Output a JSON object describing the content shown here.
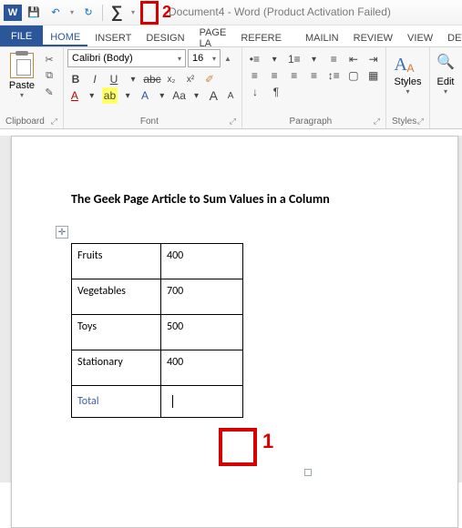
{
  "title": "Document4 - Word (Product Activation Failed)",
  "qat": {
    "word": "W",
    "save": "💾",
    "undo": "↶",
    "redo": "↻",
    "sum": "∑",
    "dropdown": "▾"
  },
  "callouts": {
    "one": "1",
    "two": "2"
  },
  "tabs": {
    "file": "FILE",
    "home": "HOME",
    "insert": "INSERT",
    "design": "DESIGN",
    "pagelayout": "PAGE LA",
    "references": "REFERE",
    "mailings": "MAILIN",
    "review": "REVIEW",
    "view": "VIEW",
    "developer": "DEVELO"
  },
  "ribbon": {
    "clipboard": {
      "paste": "Paste",
      "label": "Clipboard",
      "cut": "✂",
      "copy": "⧉",
      "fmt": "✎"
    },
    "font": {
      "name": "Calibri (Body)",
      "size": "16",
      "label": "Font",
      "bold": "B",
      "italic": "I",
      "underline": "U",
      "strike": "abc",
      "sub": "x₂",
      "sup": "x²",
      "clear": "✐",
      "fontcolor": "A",
      "highlight": "ab",
      "case": "Aa",
      "grow": "A",
      "shrink": "A",
      "drop": "▾"
    },
    "paragraph": {
      "label": "Paragraph",
      "bullets": "•≡",
      "numbers": "1≡",
      "multi": "≡",
      "decind": "⇤",
      "incind": "⇥",
      "left": "≡",
      "center": "≡",
      "right": "≡",
      "just": "≡",
      "lines": "↕≡",
      "shade": "▢",
      "border": "▦",
      "sort": "↓",
      "pilcrow": "¶"
    },
    "styles": {
      "label": "Styles",
      "text": "Styles",
      "drop": "▾"
    },
    "editing": {
      "label": "Edit",
      "find": "🔍"
    }
  },
  "doc": {
    "heading": "The Geek Page Article to Sum Values in a Column",
    "handle": "✛",
    "rows": [
      {
        "label": "Fruits",
        "value": "400"
      },
      {
        "label": "Vegetables",
        "value": "700"
      },
      {
        "label": "Toys",
        "value": "500"
      },
      {
        "label": "Stationary",
        "value": "400"
      }
    ],
    "total_label": "Total",
    "total_value": ""
  }
}
